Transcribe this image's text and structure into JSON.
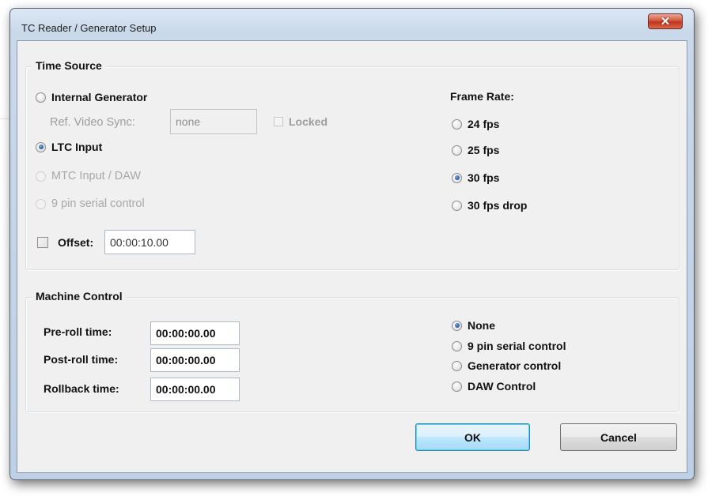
{
  "window": {
    "title": "TC Reader / Generator Setup",
    "close_glyph": "✕"
  },
  "time_source": {
    "legend": "Time Source",
    "options": {
      "internal_generator": "Internal Generator",
      "ltc_input": "LTC Input",
      "mtc_input": "MTC Input / DAW",
      "nine_pin": "9 pin serial control"
    },
    "selected": "LTC Input",
    "ref_video_sync_label": "Ref. Video Sync:",
    "ref_video_sync_value": "none",
    "locked_label": "Locked",
    "offset_label": "Offset:",
    "offset_value": "00:00:10.00",
    "offset_checked": false
  },
  "frame_rate": {
    "label": "Frame Rate:",
    "options": [
      "24 fps",
      "25 fps",
      "30 fps",
      "30 fps drop"
    ],
    "selected": "30 fps"
  },
  "machine_control": {
    "legend": "Machine Control",
    "preroll_label": "Pre-roll time:",
    "preroll_value": "00:00:00.00",
    "postroll_label": "Post-roll time:",
    "postroll_value": "00:00:00.00",
    "rollback_label": "Rollback time:",
    "rollback_value": "00:00:00.00",
    "options": [
      "None",
      "9 pin serial control",
      "Generator control",
      "DAW Control"
    ],
    "selected": "None"
  },
  "buttons": {
    "ok": "OK",
    "cancel": "Cancel"
  },
  "colors": {
    "accent": "#1e5aa8",
    "close_button": "#c1351d",
    "disabled_text": "#9d9d9d"
  }
}
